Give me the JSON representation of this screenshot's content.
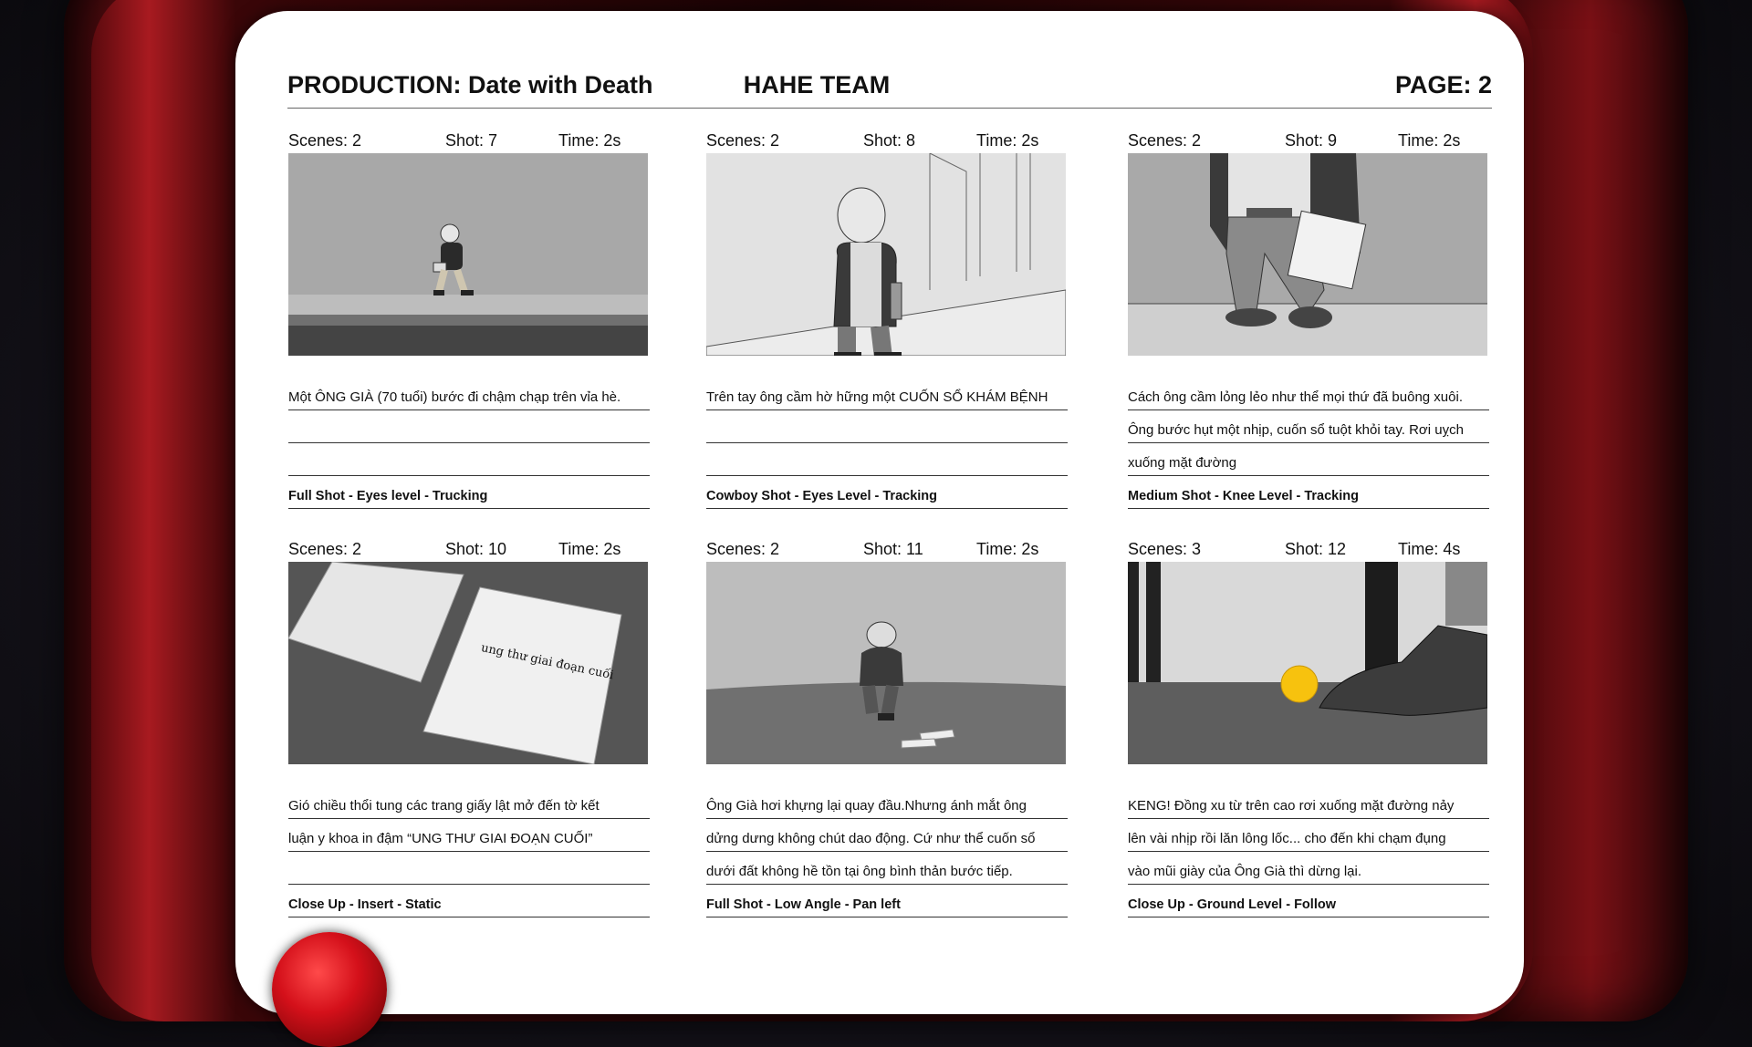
{
  "header": {
    "production": "PRODUCTION: Date with Death",
    "team": "HAHE TEAM",
    "page": "PAGE: 2"
  },
  "panels": [
    {
      "scene": "Scenes: 2",
      "shot": "Shot: 7",
      "time": "Time: 2s",
      "lines": [
        "Một ÔNG GIÀ (70 tuổi) bước đi chậm chạp trên vỉa hè.",
        "",
        ""
      ],
      "shot_desc": "Full Shot - Eyes level - Trucking"
    },
    {
      "scene": "Scenes: 2",
      "shot": "Shot: 8",
      "time": "Time: 2s",
      "lines": [
        "Trên tay ông cầm hờ hững một CUỐN SỔ KHÁM BỆNH",
        "",
        ""
      ],
      "shot_desc": "Cowboy Shot - Eyes Level - Tracking"
    },
    {
      "scene": "Scenes: 2",
      "shot": "Shot: 9",
      "time": "Time: 2s",
      "lines": [
        "Cách ông cầm lỏng lẻo như thể mọi thứ đã buông xuôi.",
        "Ông bước hụt một nhịp, cuốn sổ tuột khỏi tay. Rơi uỵch",
        "xuống mặt đường"
      ],
      "shot_desc": "Medium Shot - Knee Level - Tracking"
    },
    {
      "scene": "Scenes: 2",
      "shot": "Shot: 10",
      "time": "Time: 2s",
      "lines": [
        "Gió chiều thổi tung các trang giấy lật mở đến tờ kết",
        "luận y khoa in đậm “UNG THƯ GIAI ĐOẠN CUỐI”",
        ""
      ],
      "shot_desc": "Close Up - Insert - Static",
      "paper_text": "ung thư giai đoạn cuối"
    },
    {
      "scene": "Scenes: 2",
      "shot": "Shot: 11",
      "time": "Time: 2s",
      "lines": [
        "Ông Già hơi khựng lại quay đầu.Nhưng ánh mắt ông",
        "dửng dưng không chút dao động. Cứ như thể cuốn sổ",
        "dưới đất không hề tồn tại ông bình thản bước tiếp."
      ],
      "shot_desc": "Full Shot - Low Angle - Pan left"
    },
    {
      "scene": "Scenes: 3",
      "shot": "Shot: 12",
      "time": "Time: 4s",
      "lines": [
        "KENG! Đồng xu từ trên cao rơi xuống mặt đường nảy",
        "lên vài nhịp rồi lăn lông lốc... cho đến khi chạm đụng",
        "vào mũi giày của Ông Già thì dừng lại."
      ],
      "shot_desc": "Close Up - Ground Level - Follow"
    }
  ]
}
